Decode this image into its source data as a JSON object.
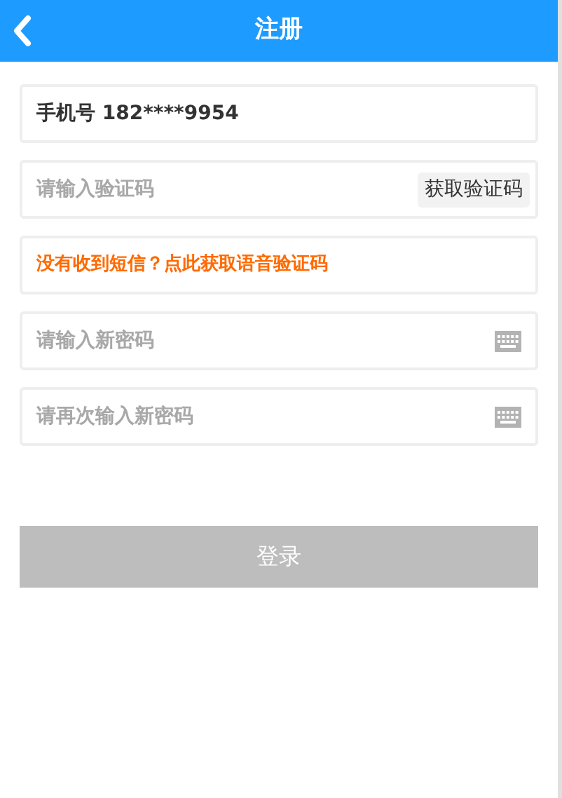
{
  "header": {
    "title": "注册"
  },
  "fields": [
    {
      "kind": "text",
      "value": "手机号 182****9954"
    },
    {
      "kind": "code",
      "placeholder": "请输入验证码",
      "button": "获取验证码"
    },
    {
      "kind": "link",
      "text": "没有收到短信？点此获取语音验证码"
    },
    {
      "kind": "password",
      "placeholder": "请输入新密码"
    },
    {
      "kind": "password",
      "placeholder": "请再次输入新密码"
    }
  ],
  "submit": {
    "label": "登录",
    "disabled": true
  }
}
